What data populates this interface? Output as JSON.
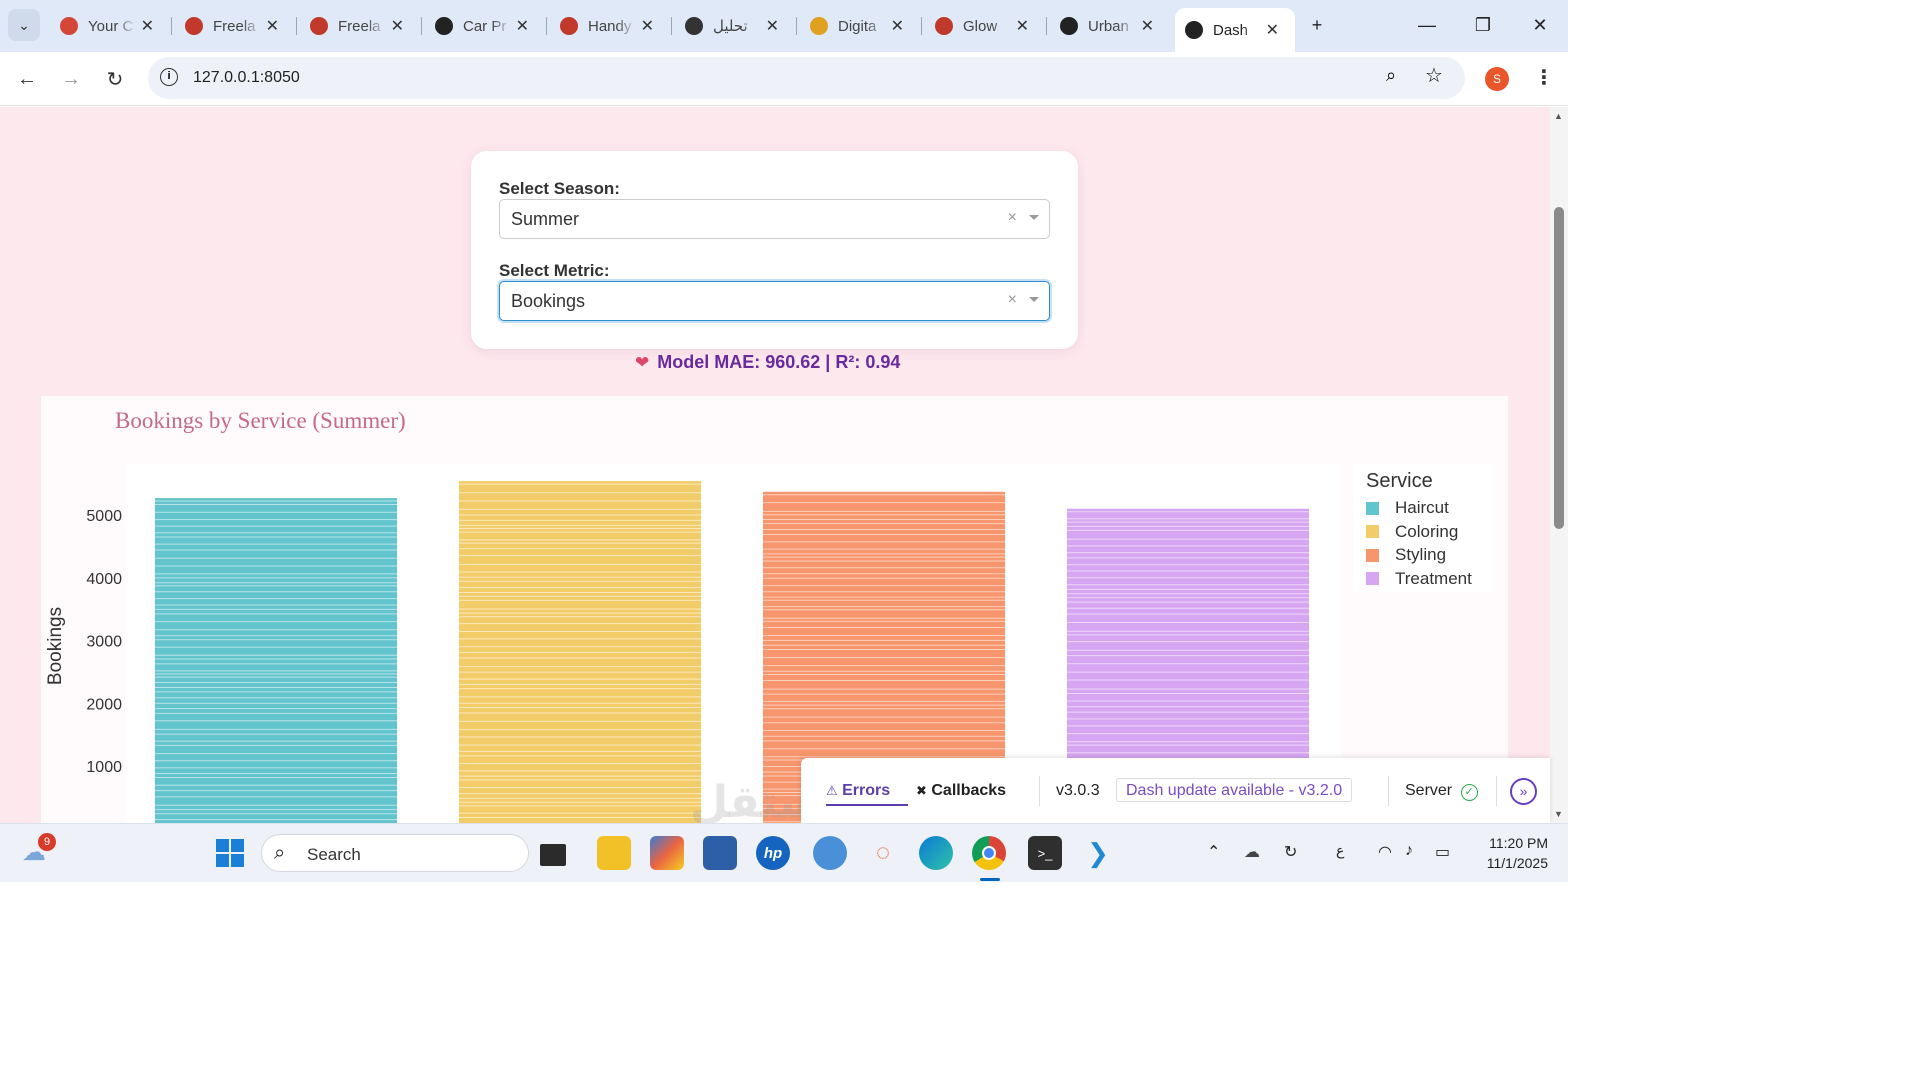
{
  "browser": {
    "tabs": [
      {
        "title": "Your C",
        "icon": "gmail-icon",
        "color": "#d44638"
      },
      {
        "title": "Freela",
        "icon": "freelancer-icon",
        "color": "#c0392b"
      },
      {
        "title": "Freela",
        "icon": "freelancer-icon",
        "color": "#c0392b"
      },
      {
        "title": "Car Pr",
        "icon": "dash-icon",
        "color": "#222222"
      },
      {
        "title": "Handy",
        "icon": "freelancer-icon",
        "color": "#c0392b"
      },
      {
        "title": "تحليل",
        "icon": "openai-icon",
        "color": "#333333"
      },
      {
        "title": "Digita",
        "icon": "chart-icon",
        "color": "#e0a020"
      },
      {
        "title": "Glow",
        "icon": "freelancer-icon",
        "color": "#c0392b"
      },
      {
        "title": "Urban",
        "icon": "dash-icon",
        "color": "#222222"
      },
      {
        "title": "Dash",
        "icon": "dash-icon",
        "color": "#222222",
        "active": true
      }
    ],
    "url": "127.0.0.1:8050",
    "profile_initial": "S"
  },
  "controls": {
    "season_label": "Select Season:",
    "season_value": "Summer",
    "metric_label": "Select Metric:",
    "metric_value": "Bookings",
    "clear_symbol": "×"
  },
  "model_metrics": "Model MAE: 960.62 | R²: 0.94",
  "chart_data": {
    "type": "bar",
    "title": "Bookings by Service (Summer)",
    "ylabel": "Bookings",
    "xlabel": "",
    "categories": [
      "Haircut",
      "Coloring",
      "Styling",
      "Treatment"
    ],
    "series": [
      {
        "name": "Haircut",
        "values": [
          5270
        ],
        "color": "#62c4cc"
      },
      {
        "name": "Coloring",
        "values": [
          5540
        ],
        "color": "#f3cc6a"
      },
      {
        "name": "Styling",
        "values": [
          5370
        ],
        "color": "#f7956c"
      },
      {
        "name": "Treatment",
        "values": [
          5100
        ],
        "color": "#d7a6f2"
      }
    ],
    "yticks": [
      1000,
      2000,
      3000,
      4000,
      5000
    ],
    "ylim": [
      0,
      5800
    ],
    "legend_title": "Service",
    "legend_position": "top-right",
    "grid": false
  },
  "debug_bar": {
    "errors_label": "Errors",
    "callbacks_label": "Callbacks",
    "version": "v3.0.3",
    "update_text": "Dash update available - v3.2.0",
    "server_label": "Server"
  },
  "taskbar": {
    "weather_badge": "9",
    "search_placeholder": "Search",
    "time": "11:20 PM",
    "date": "11/1/2025",
    "lang": "ع"
  }
}
